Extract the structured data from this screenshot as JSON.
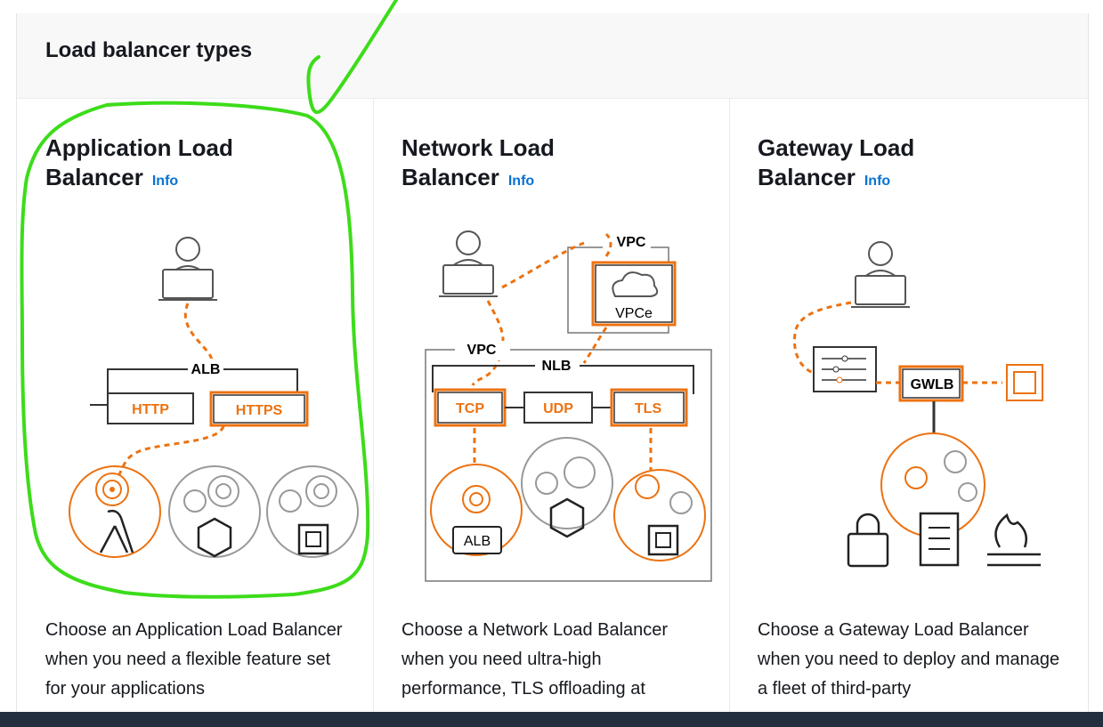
{
  "panel": {
    "title": "Load balancer types"
  },
  "cards": [
    {
      "title_line1": "Application Load",
      "title_line2": "Balancer",
      "info": "Info",
      "description": "Choose an Application Load Balancer when you need a flexible feature set for your applications",
      "diagram": {
        "group": "ALB",
        "protocols": [
          "HTTP",
          "HTTPS"
        ]
      }
    },
    {
      "title_line1": "Network Load",
      "title_line2": "Balancer",
      "info": "Info",
      "description": "Choose a Network Load Balancer when you need ultra-high performance, TLS offloading at",
      "diagram": {
        "group": "NLB",
        "vpc_a": "VPC",
        "vpc_b": "VPC",
        "endpoint": "VPCe",
        "protocols": [
          "TCP",
          "UDP",
          "TLS"
        ],
        "target": "ALB"
      }
    },
    {
      "title_line1": "Gateway Load",
      "title_line2": "Balancer",
      "info": "Info",
      "description": "Choose a Gateway Load Balancer when you need to deploy and manage a fleet of third-party",
      "diagram": {
        "node": "GWLB"
      }
    }
  ],
  "colors": {
    "accent": "#ec7211",
    "link": "#0972d3",
    "annotation": "#3ddc1a",
    "footer": "#232f3e"
  }
}
